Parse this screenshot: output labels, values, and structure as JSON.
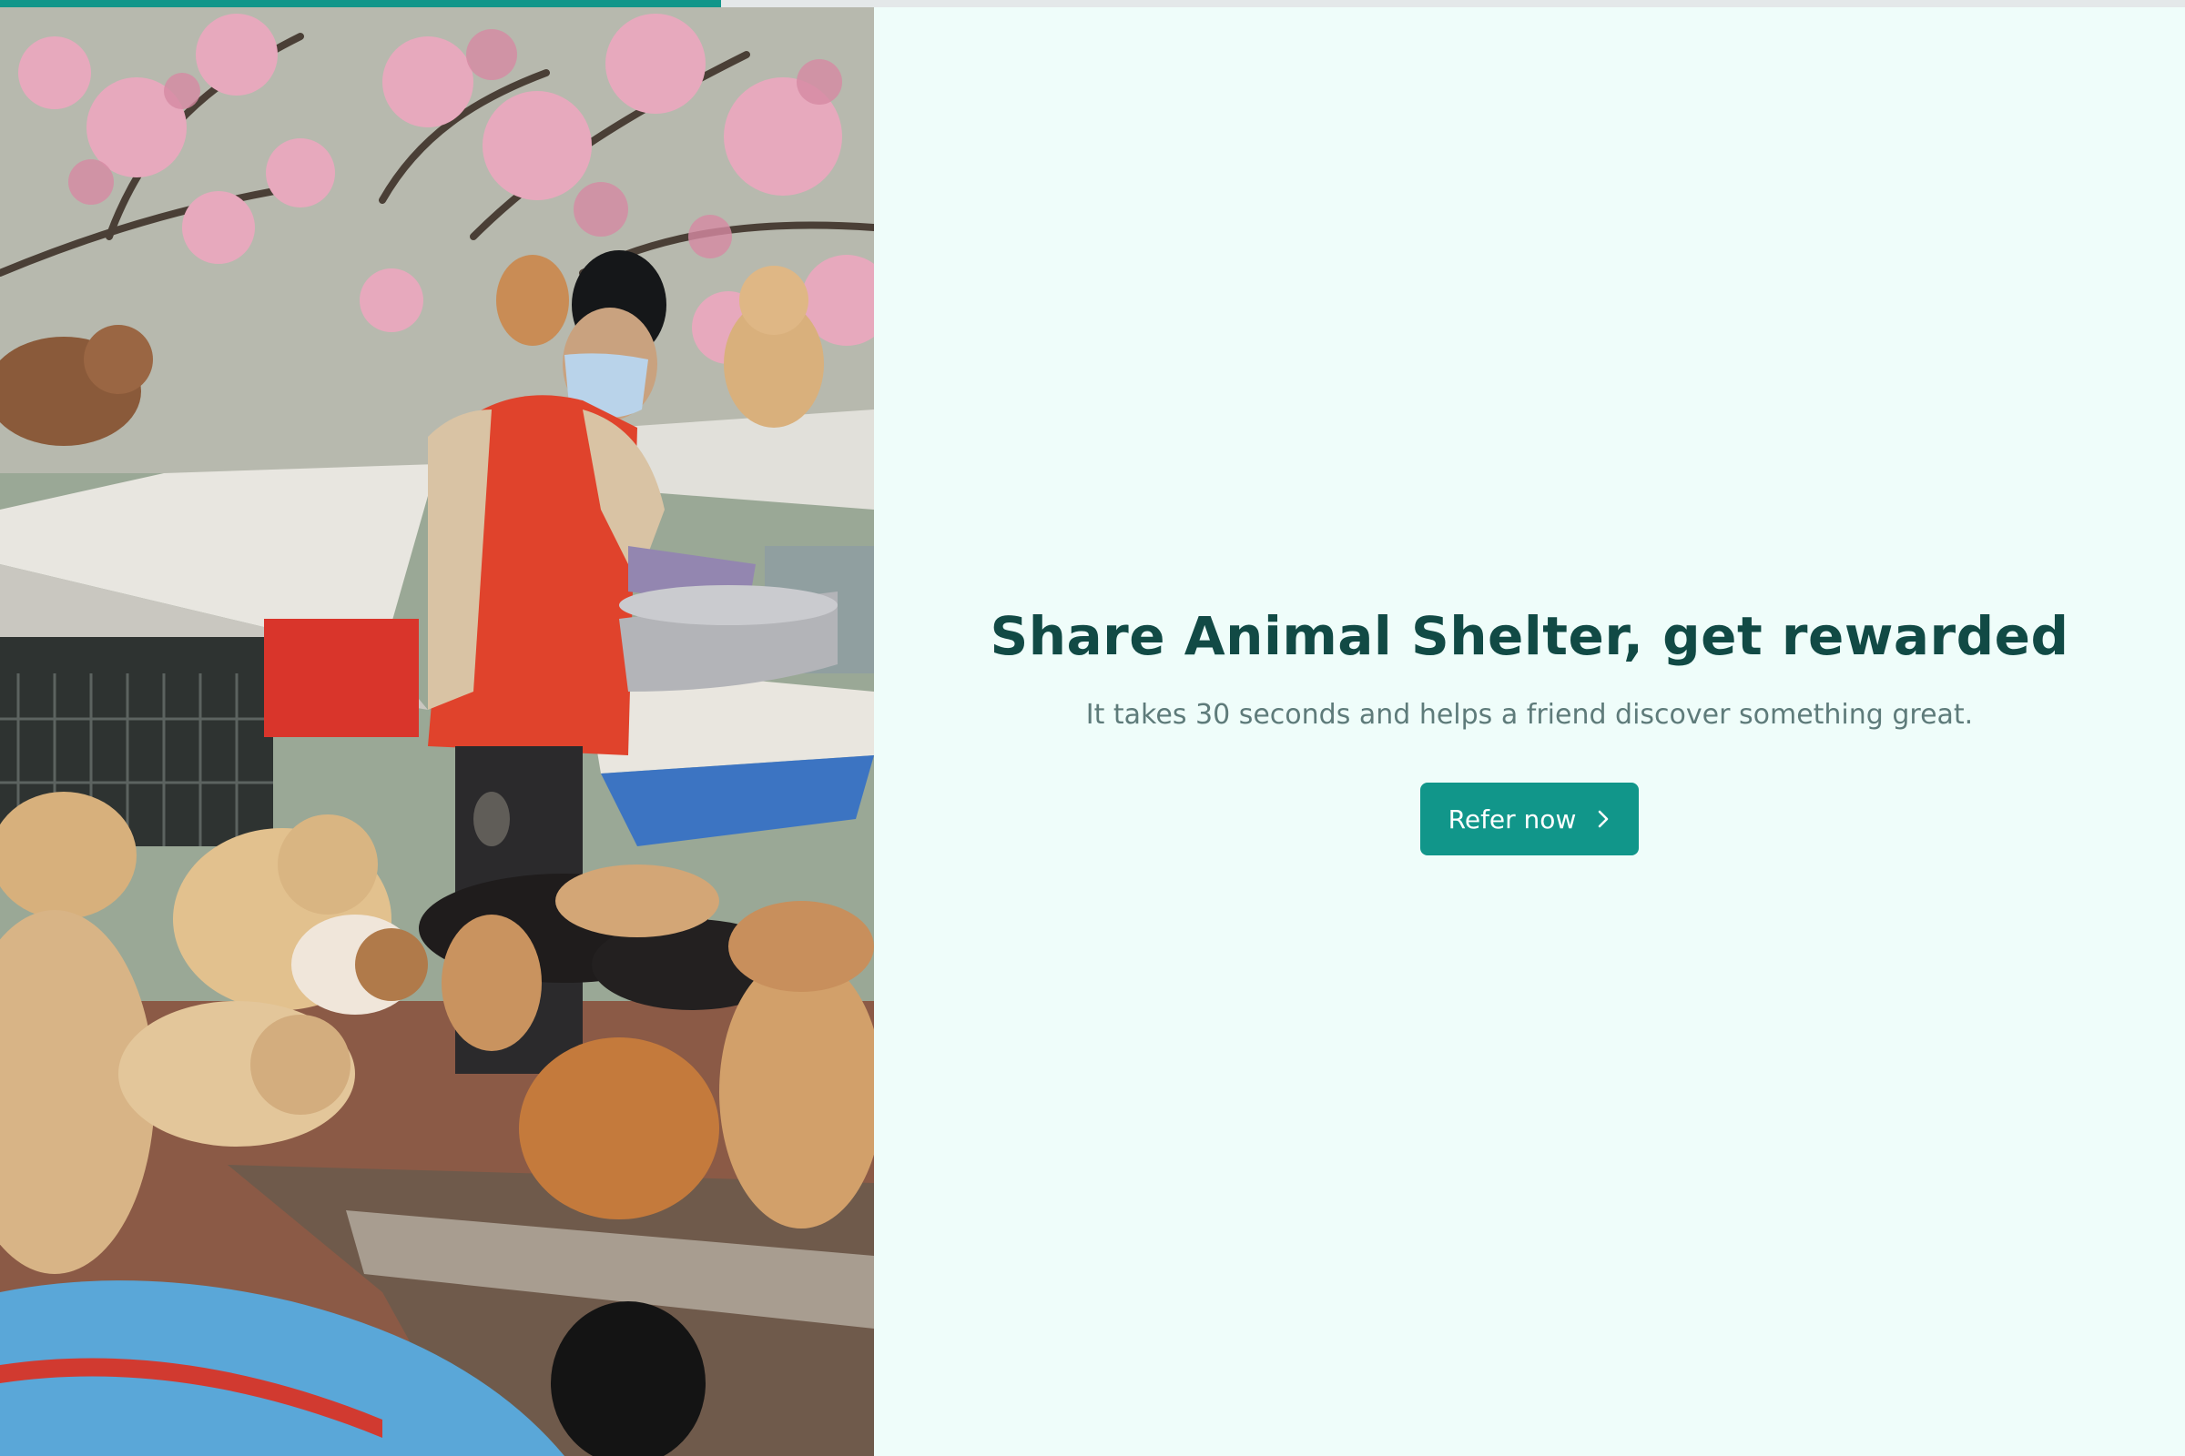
{
  "progress": {
    "value_percent": 33
  },
  "hero": {
    "title": "Share Animal Shelter, get rewarded",
    "subtitle": "It takes 30 seconds and helps a friend discover something great.",
    "cta_label": "Refer now",
    "cta_icon": "chevron-right-icon"
  },
  "photo": {
    "subject": "woman in red vest and face mask feeding a crowd of shelter dogs under blossoming trees"
  },
  "colors": {
    "accent": "#11968a",
    "heading": "#114a45",
    "subtext": "#5e7b7a",
    "background": "#effdfa",
    "progress_track": "#e4e8e9"
  }
}
